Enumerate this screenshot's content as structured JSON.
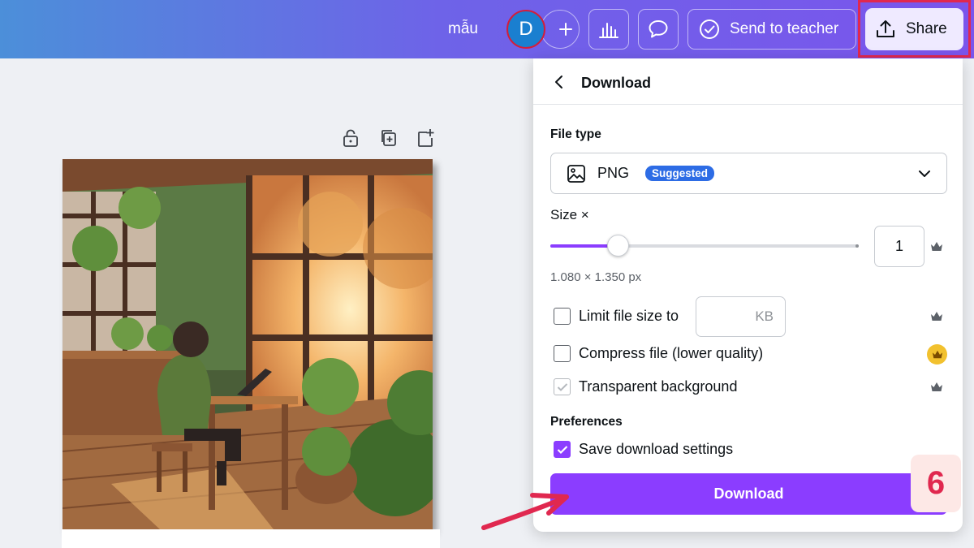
{
  "topbar": {
    "design_name": "mẫu",
    "avatar_initial": "D",
    "send_to_teacher_label": "Send to teacher",
    "share_label": "Share"
  },
  "panel": {
    "title": "Download",
    "file_type_label": "File type",
    "file_type_value": "PNG",
    "file_type_badge": "Suggested",
    "size_label": "Size ×",
    "size_value": "1",
    "size_slider_fraction": 0.22,
    "dimensions": "1.080 × 1.350 px",
    "limit_file_size_label": "Limit file size to",
    "limit_file_size_unit": "KB",
    "limit_file_size_checked": false,
    "compress_label": "Compress file (lower quality)",
    "compress_checked": false,
    "transparent_label": "Transparent background",
    "transparent_checked": true,
    "preferences_label": "Preferences",
    "save_settings_label": "Save download settings",
    "save_settings_checked": true,
    "download_button": "Download"
  },
  "annotation": {
    "step_number": "6"
  },
  "colors": {
    "accent": "#8b3dff",
    "badge_blue": "#2d6ce5",
    "highlight_red": "#e0284f",
    "crown_gold": "#f2c12e"
  },
  "icons": {
    "page_tools": [
      "lock-icon",
      "duplicate-icon",
      "add-page-icon"
    ],
    "topbar": [
      "plus-icon",
      "insights-icon",
      "comment-icon",
      "check-circle-icon",
      "share-upload-icon"
    ]
  }
}
